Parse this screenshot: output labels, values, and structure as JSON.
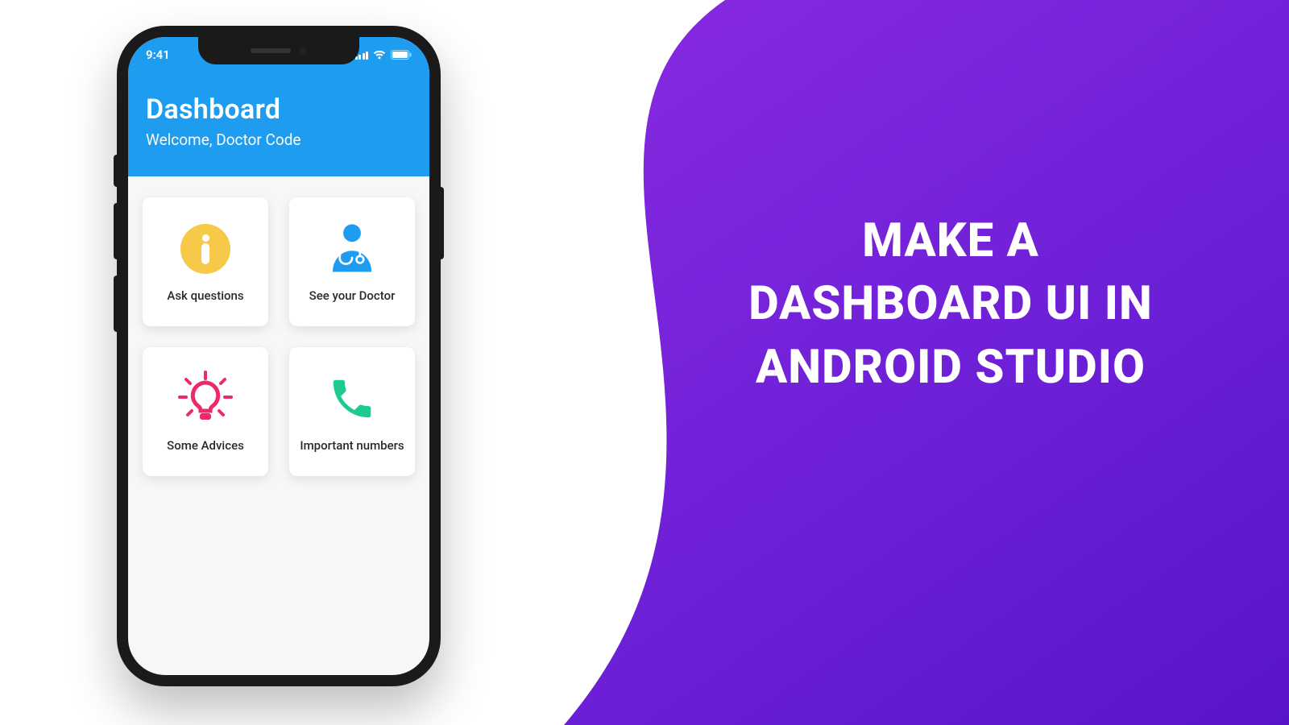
{
  "promo": {
    "line1": "MAKE A",
    "line2": "DASHBOARD UI IN",
    "line3": "ANDROID STUDIO"
  },
  "statusbar": {
    "time": "9:41"
  },
  "header": {
    "title": "Dashboard",
    "subtitle": "Welcome, Doctor Code"
  },
  "cards": {
    "ask": {
      "label": "Ask questions",
      "icon": "info-icon"
    },
    "doctor": {
      "label": "See your Doctor",
      "icon": "doctor-icon"
    },
    "advices": {
      "label": "Some Advices",
      "icon": "lightbulb-icon"
    },
    "numbers": {
      "label": "Important numbers",
      "icon": "phone-icon"
    }
  },
  "colors": {
    "header": "#1e9cf0",
    "info": "#f7c948",
    "doctor": "#1e9cf0",
    "bulb": "#ec2a6a",
    "phone": "#1ecb8f",
    "wave": "#7a22dd"
  }
}
